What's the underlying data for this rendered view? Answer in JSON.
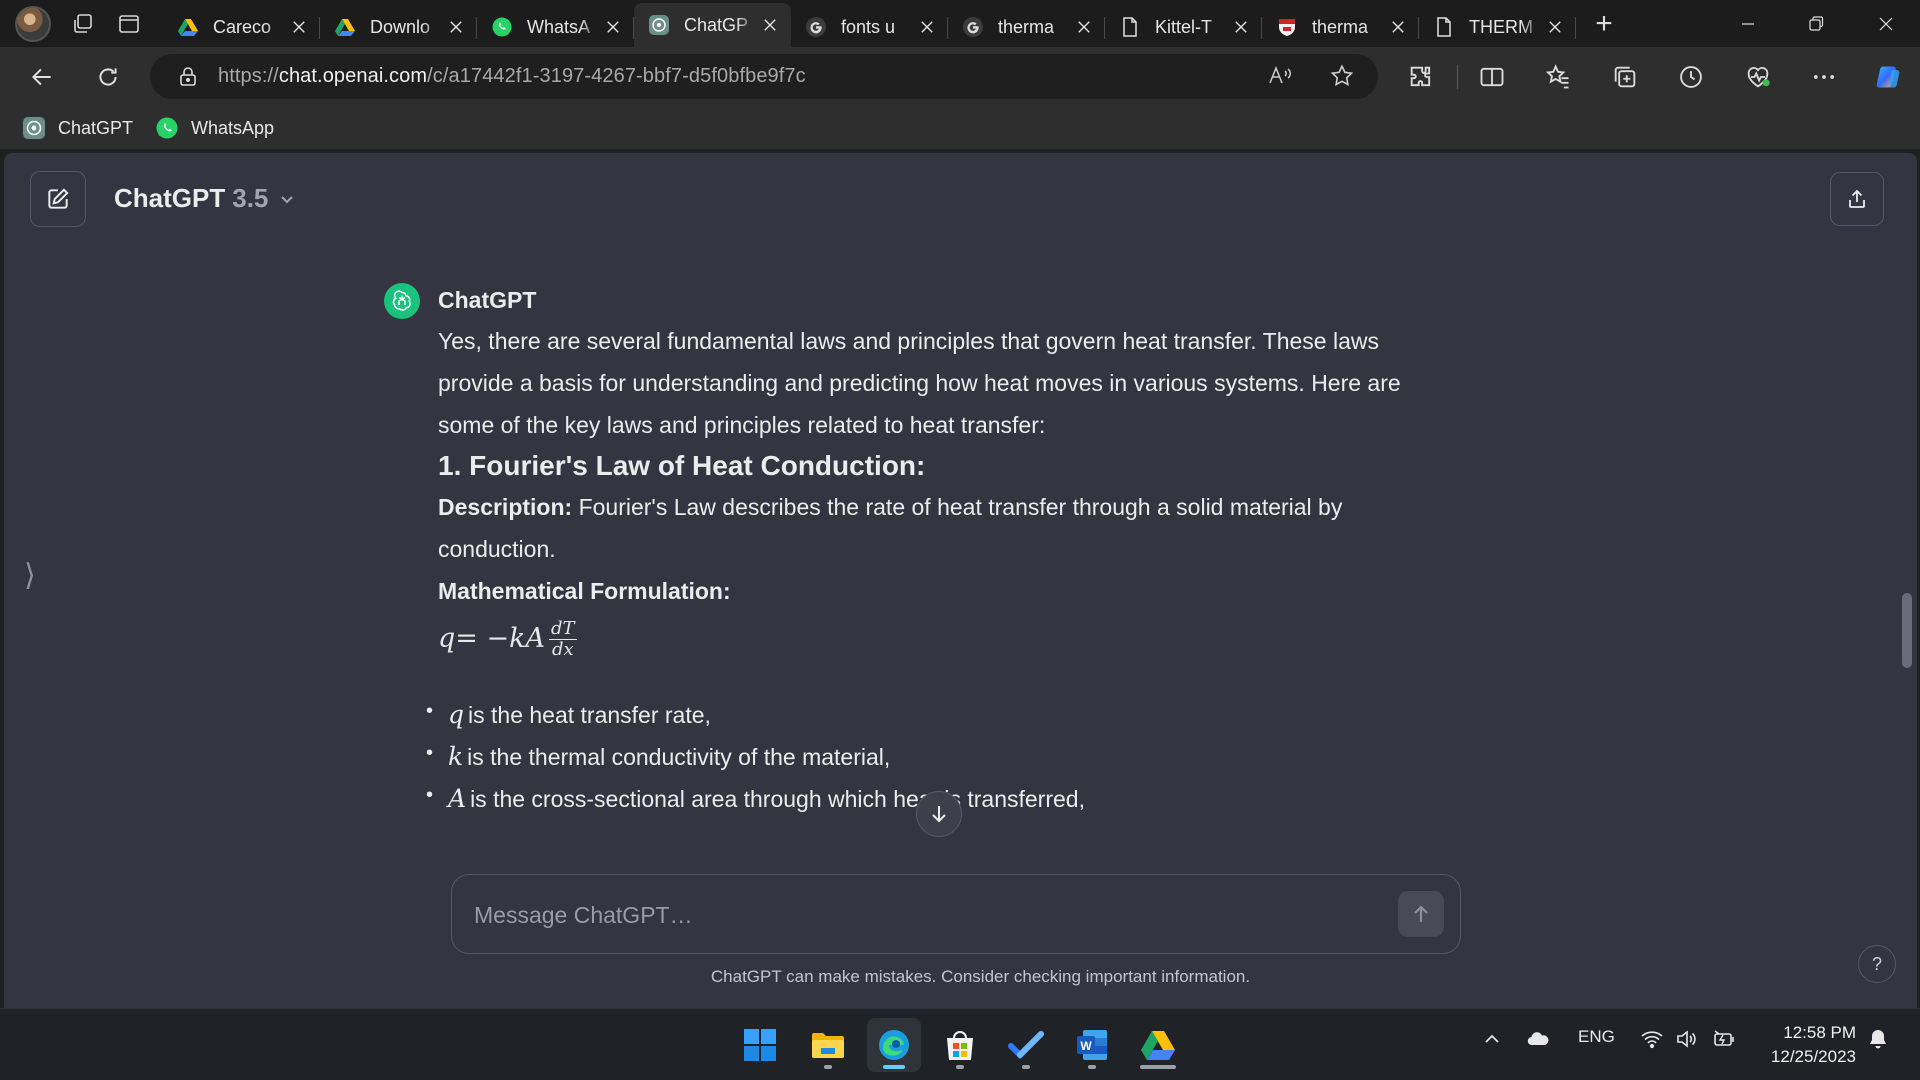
{
  "browser": {
    "tabs": [
      {
        "label": "Careco",
        "icon": "google-drive-icon",
        "active": false
      },
      {
        "label": "Downlo",
        "icon": "google-drive-icon",
        "active": false
      },
      {
        "label": "WhatsA",
        "icon": "whatsapp-icon",
        "active": false
      },
      {
        "label": "ChatGP",
        "icon": "chatgpt-icon",
        "active": true
      },
      {
        "label": "fonts u",
        "icon": "google-icon",
        "active": false
      },
      {
        "label": "therma",
        "icon": "google-icon",
        "active": false
      },
      {
        "label": "Kittel-T",
        "icon": "document-icon",
        "active": false
      },
      {
        "label": "therma",
        "icon": "university-crest-icon",
        "active": false
      },
      {
        "label": "THERM",
        "icon": "document-icon",
        "active": false
      }
    ],
    "address": {
      "scheme": "https://",
      "host": "chat.openai.com",
      "path": "/c/a17442f1-3197-4267-bbf7-d5f0bfbe9f7c"
    },
    "favorites": [
      {
        "label": "ChatGPT",
        "icon": "chatgpt-icon"
      },
      {
        "label": "WhatsApp",
        "icon": "whatsapp-icon"
      }
    ]
  },
  "chat": {
    "model_name": "ChatGPT",
    "model_version": "3.5",
    "author": "ChatGPT",
    "intro": "Yes, there are several fundamental laws and principles that govern heat transfer. These laws provide a basis for understanding and predicting how heat moves in various systems. Here are some of the key laws and principles related to heat transfer:",
    "heading": "1. Fourier's Law of Heat Conduction:",
    "description_label": "Description:",
    "description_text": " Fourier's Law describes the rate of heat transfer through a solid material by conduction.",
    "formulation_label": "Mathematical Formulation:",
    "formula": {
      "lhs": "q",
      "eq": " = −",
      "k": "k",
      "A": "A",
      "num": "dT",
      "den": "dx"
    },
    "bullets": [
      {
        "var": "q",
        "text": "is the heat transfer rate,"
      },
      {
        "var": "k",
        "text": "is the thermal conductivity of the material,"
      },
      {
        "var": "A",
        "text": "is the cross-sectional area through which heat is transferred,"
      }
    ],
    "composer_placeholder": "Message ChatGPT…",
    "disclaimer": "ChatGPT can make mistakes. Consider checking important information.",
    "help_label": "?"
  },
  "taskbar": {
    "apps": [
      "windows-start-icon",
      "file-explorer-icon",
      "edge-icon",
      "microsoft-store-icon",
      "todo-icon",
      "word-icon",
      "google-drive-icon"
    ],
    "language": "ENG",
    "time": "12:58 PM",
    "date": "12/25/2023"
  },
  "colors": {
    "accent_green": "#19c37d",
    "page_bg": "#343541",
    "browser_chrome": "#2e2e2e",
    "taskbar_bg": "#1f2328"
  }
}
